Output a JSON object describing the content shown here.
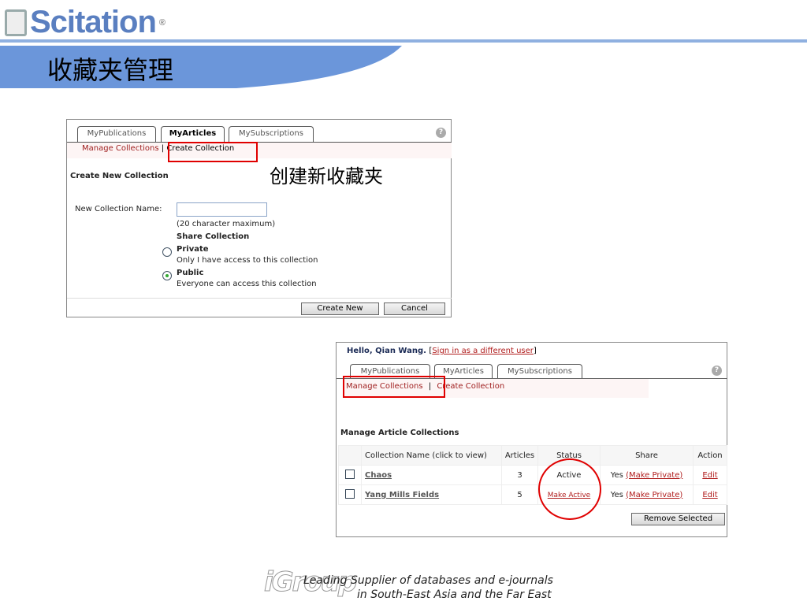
{
  "header": {
    "logo_text": "Scitation",
    "logo_reg": "®",
    "title": "收藏夹管理"
  },
  "panel1": {
    "tabs": [
      "MyPublications",
      "MyArticles",
      "MySubscriptions"
    ],
    "help": "?",
    "subnav": {
      "manage": "Manage Collections",
      "sep": "|",
      "create": "Create Collection"
    },
    "annotation": "创建新收藏夹",
    "heading": "Create New Collection",
    "name_label": "New Collection Name:",
    "name_value": "",
    "char_hint": "(20 character maximum)",
    "share_heading": "Share Collection",
    "private_label": "Private",
    "private_desc": "Only I have access to this collection",
    "public_label": "Public",
    "public_desc": "Everyone can access this collection",
    "create_button": "Create New",
    "cancel_button": "Cancel"
  },
  "panel2": {
    "greeting": "Hello, Qian Wang.",
    "bracket_open": "[",
    "signin_link": "Sign in as a different user",
    "bracket_close": "]",
    "tabs": [
      "MyPublications",
      "MyArticles",
      "MySubscriptions"
    ],
    "help": "?",
    "subnav": {
      "manage": "Manage Collections",
      "sep": "|",
      "create": "Create Collection"
    },
    "heading": "Manage Article Collections",
    "columns": [
      "Collection Name   (click to view)",
      "Articles",
      "Status",
      "Share",
      "Action"
    ],
    "rows": [
      {
        "name": "Chaos",
        "articles": "3",
        "status": "Active",
        "share": "Yes",
        "share_link": "(Make Private)",
        "action": "Edit"
      },
      {
        "name": "Yang Mills Fields",
        "articles": "5",
        "status": "Make Active",
        "share": "Yes",
        "share_link": "(Make Private)",
        "action": "Edit"
      }
    ],
    "remove_button": "Remove Selected"
  },
  "footer": {
    "brand": "iGroup",
    "line1": "Leading Supplier of databases and e-journals",
    "line2": "in South-East Asia and the Far East"
  }
}
